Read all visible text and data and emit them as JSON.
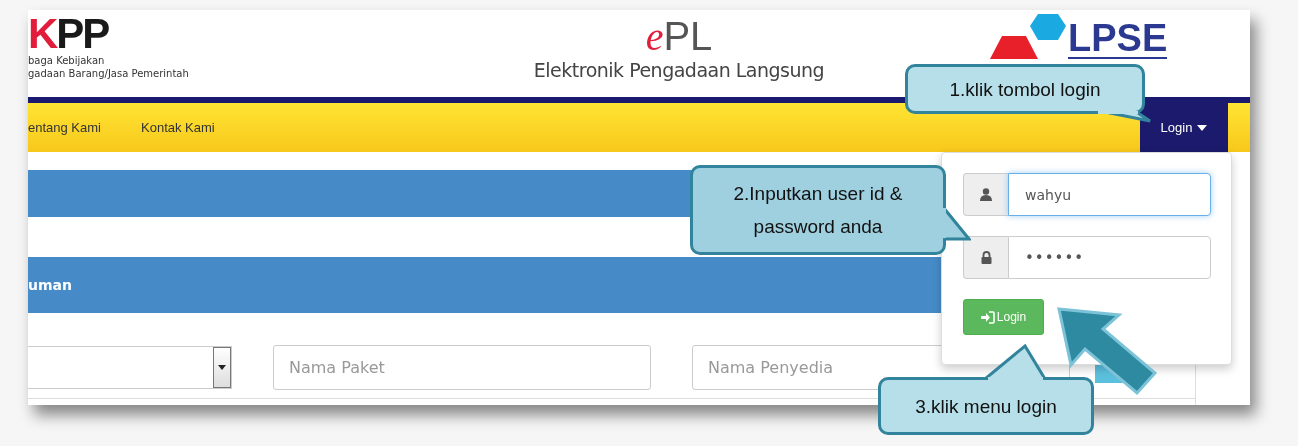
{
  "header": {
    "left_logo": {
      "mark_red": "K",
      "mark_black": "PP",
      "line_1": "baga Kebijakan",
      "line_2": "gadaan Barang/Jasa Pemerintah"
    },
    "center_logo": {
      "e": "e",
      "pl": "PL",
      "subtitle": "Elektronik Pengadaan Langsung"
    },
    "right_logo": {
      "text": "LPSE"
    }
  },
  "nav": {
    "items": [
      {
        "label": "entang Kami"
      },
      {
        "label": "Kontak Kami"
      }
    ],
    "login_menu": {
      "label": "Login",
      "expanded": true
    }
  },
  "content": {
    "bars": [
      {
        "kind": "band"
      },
      {
        "kind": "heading",
        "title": "uman"
      }
    ],
    "filters": [
      {
        "kind": "select"
      },
      {
        "kind": "text",
        "placeholder": "Nama Paket"
      },
      {
        "kind": "text",
        "placeholder": "Nama Penyedia"
      },
      {
        "kind": "button"
      }
    ]
  },
  "login_form": {
    "username": {
      "value": "wahyu",
      "focused": true
    },
    "password": {
      "value": "••••••"
    },
    "button": "Login"
  },
  "callouts": [
    {
      "text": "1.klik tombol login"
    },
    {
      "text": "2.Inputkan user id & password anda"
    },
    {
      "text": "3.klik menu login"
    }
  ]
}
